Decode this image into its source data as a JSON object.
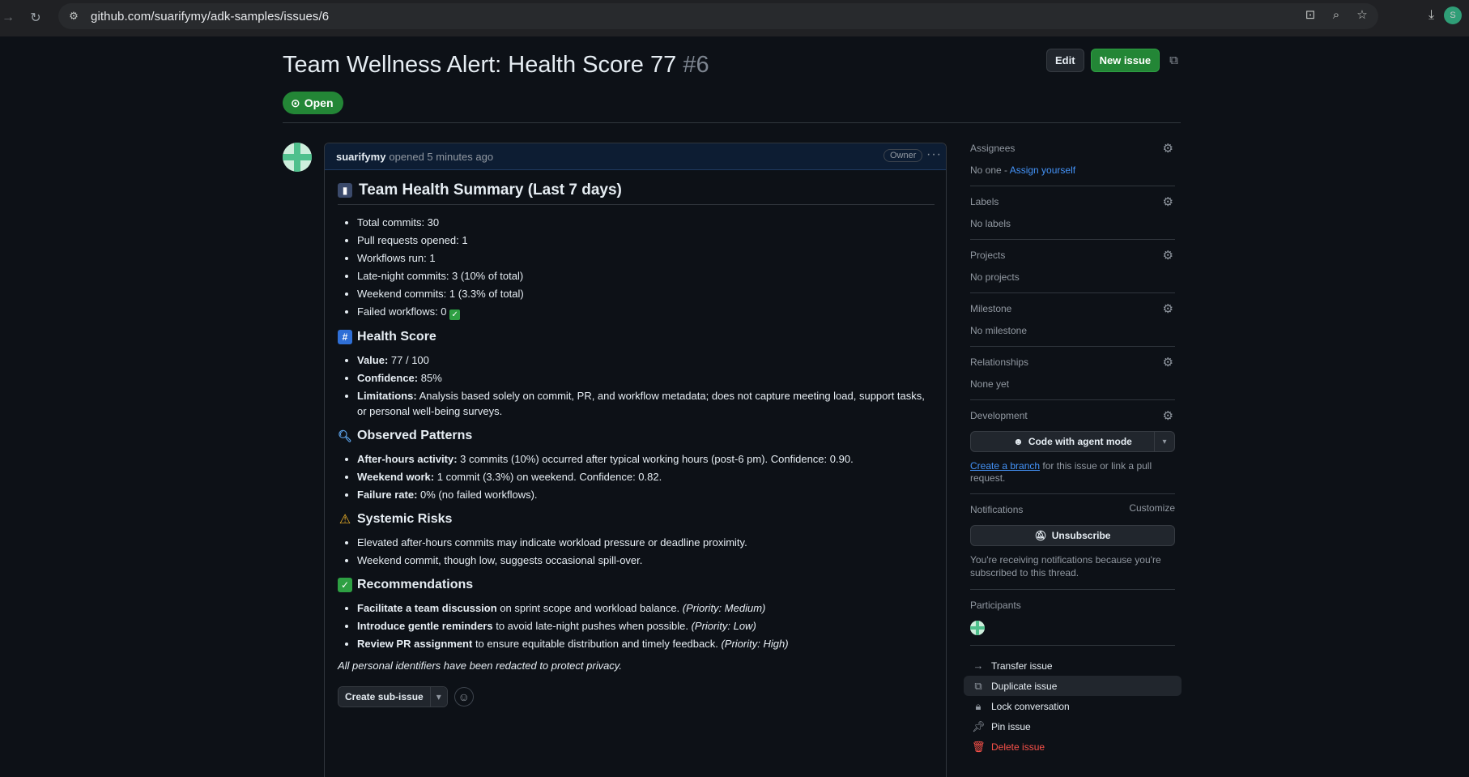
{
  "browser": {
    "url": "github.com/suarifymy/adk-samples/issues/6",
    "profile_initials": "S"
  },
  "issue": {
    "title": "Team Wellness Alert: Health Score 77",
    "number": "#6",
    "state": "Open",
    "edit_label": "Edit",
    "new_issue_label": "New issue"
  },
  "comment": {
    "author": "suarifymy",
    "meta": "opened 5 minutes ago",
    "badge": "Owner",
    "summary_heading": "Team Health Summary (Last 7 days)",
    "summary_items": [
      "Total commits: 30",
      "Pull requests opened: 1",
      "Workflows run: 1",
      "Late-night commits: 3 (10% of total)",
      "Weekend commits: 1 (3.3% of total)",
      "Failed workflows: 0"
    ],
    "score_heading": "Health Score",
    "score_items": [
      {
        "label": "Value:",
        "text": " 77 / 100"
      },
      {
        "label": "Confidence:",
        "text": " 85%"
      },
      {
        "label": "Limitations:",
        "text": " Analysis based solely on commit, PR, and workflow metadata; does not capture meeting load, support tasks, or personal well-being surveys."
      }
    ],
    "patterns_heading": "Observed Patterns",
    "patterns_items": [
      {
        "label": "After-hours activity:",
        "text": " 3 commits (10%) occurred after typical working hours (post-6 pm). Confidence: 0.90."
      },
      {
        "label": "Weekend work:",
        "text": " 1 commit (3.3%) on weekend. Confidence: 0.82."
      },
      {
        "label": "Failure rate:",
        "text": " 0% (no failed workflows)."
      }
    ],
    "risks_heading": "Systemic Risks",
    "risks_items": [
      "Elevated after-hours commits may indicate workload pressure or deadline proximity.",
      "Weekend commit, though low, suggests occasional spill-over."
    ],
    "recs_heading": "Recommendations",
    "recs_items": [
      {
        "label": "Facilitate a team discussion",
        "text": " on sprint scope and workload balance. ",
        "em": "(Priority: Medium)"
      },
      {
        "label": "Introduce gentle reminders",
        "text": " to avoid late-night pushes when possible. ",
        "em": "(Priority: Low)"
      },
      {
        "label": "Review PR assignment",
        "text": " to ensure equitable distribution and timely feedback. ",
        "em": "(Priority: High)"
      }
    ],
    "privacy_note": "All personal identifiers have been redacted to protect privacy.",
    "sub_issue_label": "Create sub-issue"
  },
  "sidebar": {
    "assignees_label": "Assignees",
    "assignees_text": "No one - ",
    "assign_yourself": "Assign yourself",
    "labels_label": "Labels",
    "labels_text": "No labels",
    "projects_label": "Projects",
    "projects_text": "No projects",
    "milestone_label": "Milestone",
    "milestone_text": "No milestone",
    "relationships_label": "Relationships",
    "relationships_text": "None yet",
    "development_label": "Development",
    "code_agent_label": "Code with agent mode",
    "create_branch": "Create a branch",
    "branch_text": " for this issue or link a pull request.",
    "notifications_label": "Notifications",
    "customize": "Customize",
    "unsubscribe": "Unsubscribe",
    "notif_text": "You're receiving notifications because you're subscribed to this thread.",
    "participants_label": "Participants",
    "actions": {
      "transfer": "Transfer issue",
      "duplicate": "Duplicate issue",
      "lock": "Lock conversation",
      "pin": "Pin issue",
      "delete": "Delete issue"
    }
  }
}
